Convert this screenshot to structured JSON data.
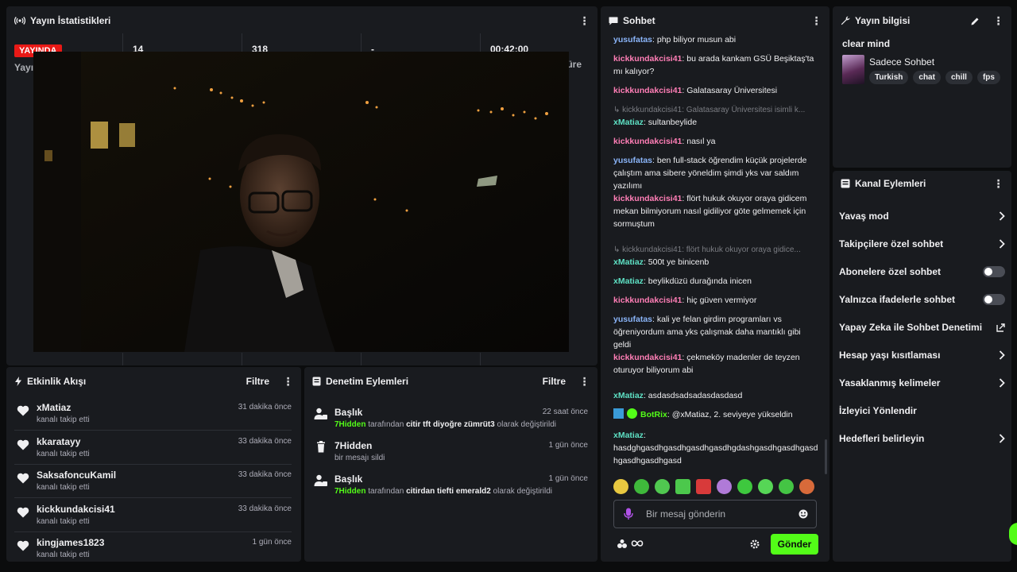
{
  "colors": {
    "accent": "#53fc18",
    "live": "#e91916",
    "panel": "#191b1f",
    "bg": "#0b0c0d"
  },
  "stats": {
    "title": "Yayın İstatistikleri",
    "live_badge": "YAYINDA",
    "viewers": "14",
    "followers": "318",
    "subs": "-",
    "duration": "00:42:00",
    "label_left": "Yayı",
    "label_right": "üre"
  },
  "activity": {
    "title": "Etkinlik Akışı",
    "filter_label": "Filtre",
    "items": [
      {
        "user": "xMatiaz",
        "action": "kanalı takip etti",
        "time": "31 dakika önce"
      },
      {
        "user": "kkaratayy",
        "action": "kanalı takip etti",
        "time": "33 dakika önce"
      },
      {
        "user": "SaksafoncuKamil",
        "action": "kanalı takip etti",
        "time": "33 dakika önce"
      },
      {
        "user": "kickkundakcisi41",
        "action": "kanalı takip etti",
        "time": "33 dakika önce"
      },
      {
        "user": "kingjames1823",
        "action": "kanalı takip etti",
        "time": "1 gün önce"
      }
    ]
  },
  "moderation": {
    "title": "Denetim Eylemleri",
    "filter_label": "Filtre",
    "items": [
      {
        "head": "Başlık",
        "mod": "7Hidden",
        "by": "tarafından",
        "value": "citir tft diyoğre zümrüt3",
        "tail": "olarak değiştirildi",
        "time": "22 saat önce"
      },
      {
        "head": "7Hidden",
        "desc": "bir mesajı sildi",
        "time": "1 gün önce"
      },
      {
        "head": "Başlık",
        "mod": "7Hidden",
        "by": "tarafından",
        "value": "citirdan tiefti emerald2",
        "tail": "olarak değiştirildi",
        "time": "1 gün önce"
      }
    ]
  },
  "chat": {
    "title": "Sohbet",
    "placeholder": "Bir mesaj gönderin",
    "send_label": "Gönder",
    "messages": [
      {
        "user": "yusufatas",
        "text": "php biliyor musun abi"
      },
      {
        "user": "kickkundakcisi41",
        "text": "bu arada kankam GSÜ Beşiktaş'ta mı kalıyor?"
      },
      {
        "user": "kickkundakcisi41",
        "text": "Galatasaray Üniversitesi"
      },
      {
        "reply": "kickkundakcisi41: Galatasaray Üniversitesi isimli k..."
      },
      {
        "user": "xMatiaz",
        "text": "sultanbeylide"
      },
      {
        "user": "kickkundakcisi41",
        "text": "nasıl ya"
      },
      {
        "user": "yusufatas",
        "text": "ben full-stack öğrendim küçük projelerde çalıştım ama sibere yöneldim şimdi yks var saldım yazılımı"
      },
      {
        "user": "kickkundakcisi41",
        "text": "flört hukuk okuyor oraya gidicem mekan bilmiyorum nasıl gidiliyor göte gelmemek için sormuştum"
      },
      {
        "reply": "kickkundakcisi41: flört hukuk okuyor oraya gidice..."
      },
      {
        "user": "xMatiaz",
        "text": "500t ye binicenb"
      },
      {
        "user": "xMatiaz",
        "text": "beylikdüzü durağında inicen"
      },
      {
        "user": "kickkundakcisi41",
        "text": "hiç güven vermiyor"
      },
      {
        "user": "yusufatas",
        "text": "kali ye felan girdim programları vs öğreniyordum ama yks çalışmak daha mantıklı gibi geldi"
      },
      {
        "user": "kickkundakcisi41",
        "text": "çekmeköy madenler de teyzen oturuyor biliyorum abi"
      },
      {
        "user": "xMatiaz",
        "text": "asdasdsadsadasdasdasd"
      },
      {
        "user": "BotRix",
        "text": "@xMatiaz, 2. seviyeye yükseldin"
      },
      {
        "user": "xMatiaz",
        "text": "hasdghgasdhgasdhgasdhgasdhgdashgasdhgasdhgasdhgasdhgasdhgasd"
      }
    ]
  },
  "info": {
    "title": "Yayın bilgisi",
    "stream_title": "clear mind",
    "category": "Sadece Sohbet",
    "tags": [
      "Turkish",
      "chat",
      "chill",
      "fps"
    ]
  },
  "actions": {
    "title": "Kanal Eylemleri",
    "items": [
      {
        "label": "Yavaş mod",
        "kind": "chevron"
      },
      {
        "label": "Takipçilere özel sohbet",
        "kind": "chevron"
      },
      {
        "label": "Abonelere özel sohbet",
        "kind": "toggle",
        "enabled": false
      },
      {
        "label": "Yalnızca ifadelerle sohbet",
        "kind": "toggle",
        "enabled": false
      },
      {
        "label": "Yapay Zeka ile Sohbet Denetimi",
        "kind": "external"
      },
      {
        "label": "Hesap yaşı kısıtlaması",
        "kind": "chevron"
      },
      {
        "label": "Yasaklanmış kelimeler",
        "kind": "chevron"
      },
      {
        "label": "İzleyici Yönlendir",
        "kind": "none"
      },
      {
        "label": "Hedefleri belirleyin",
        "kind": "chevron"
      }
    ]
  }
}
